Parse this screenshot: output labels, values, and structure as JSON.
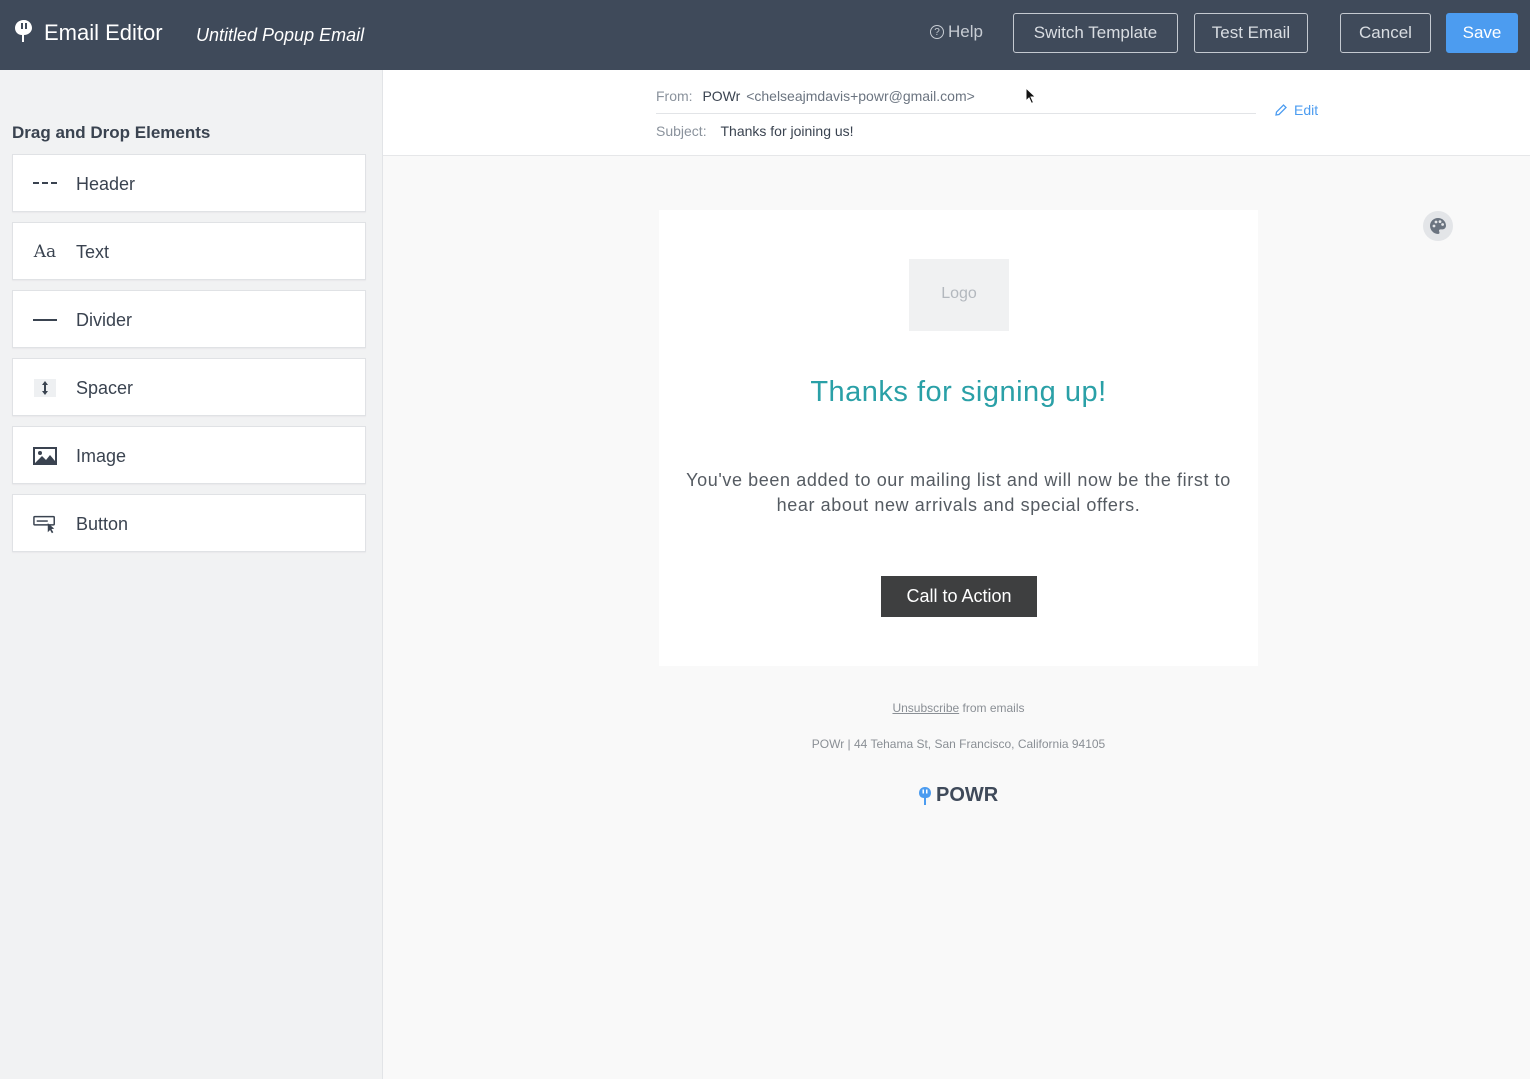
{
  "topbar": {
    "app_title": "Email Editor",
    "doc_title": "Untitled Popup Email",
    "help_label": "Help",
    "switch_template_label": "Switch Template",
    "test_email_label": "Test Email",
    "cancel_label": "Cancel",
    "save_label": "Save"
  },
  "sidebar": {
    "title": "Drag and Drop Elements",
    "items": [
      {
        "label": "Header",
        "icon": "header-dashes-icon"
      },
      {
        "label": "Text",
        "icon": "text-aa-icon"
      },
      {
        "label": "Divider",
        "icon": "divider-line-icon"
      },
      {
        "label": "Spacer",
        "icon": "spacer-arrows-icon"
      },
      {
        "label": "Image",
        "icon": "image-icon"
      },
      {
        "label": "Button",
        "icon": "button-cursor-icon"
      }
    ]
  },
  "meta": {
    "from_key": "From:",
    "from_name": "POWr",
    "from_email": "<chelseajmdavis+powr@gmail.com>",
    "subject_key": "Subject:",
    "subject_value": "Thanks for joining us!",
    "edit_label": "Edit"
  },
  "email": {
    "logo_placeholder": "Logo",
    "headline": "Thanks for signing up!",
    "body": "You've been added to our mailing list and will now be the first to hear about new arrivals and special offers.",
    "cta_label": "Call to Action",
    "unsubscribe_link": "Unsubscribe",
    "unsubscribe_rest": " from emails",
    "address": "POWr | 44 Tehama St, San Francisco, California 94105",
    "footer_brand": "POWR"
  },
  "colors": {
    "topbar_bg": "#3f4a5a",
    "save_accent": "#4c9cf0",
    "headline_teal": "#2aa0a7",
    "cta_bg": "#3e3f40"
  }
}
